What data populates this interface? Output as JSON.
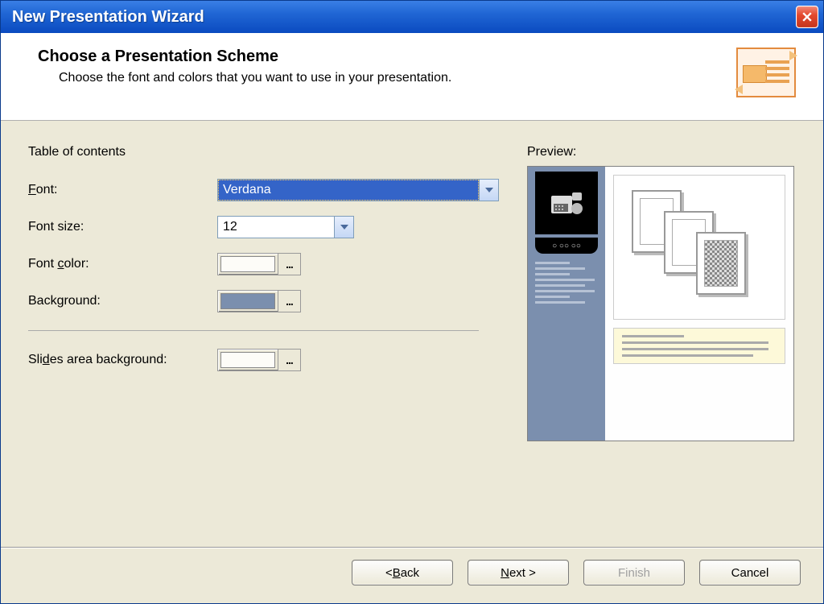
{
  "window": {
    "title": "New Presentation Wizard"
  },
  "header": {
    "heading": "Choose a Presentation Scheme",
    "subtext": "Choose the font and colors that you want to use in your presentation."
  },
  "toc": {
    "section_label": "Table of contents",
    "font_label": "Font:",
    "font_value": "Verdana",
    "fontsize_label": "Font size:",
    "fontsize_value": "12",
    "fontcolor_label": "Font color:",
    "fontcolor_value": "#FDFCF8",
    "background_label": "Background:",
    "background_value": "#7B8FAE",
    "more_label": "..."
  },
  "slides": {
    "area_bg_label": "Slides area background:",
    "area_bg_value": "#FDFCF8",
    "more_label": "..."
  },
  "preview": {
    "label": "Preview:",
    "controls_text": "○ ○○ ○○"
  },
  "buttons": {
    "back": "< Back",
    "back_u": "B",
    "next": "Next >",
    "next_u": "N",
    "finish": "Finish",
    "cancel": "Cancel"
  }
}
